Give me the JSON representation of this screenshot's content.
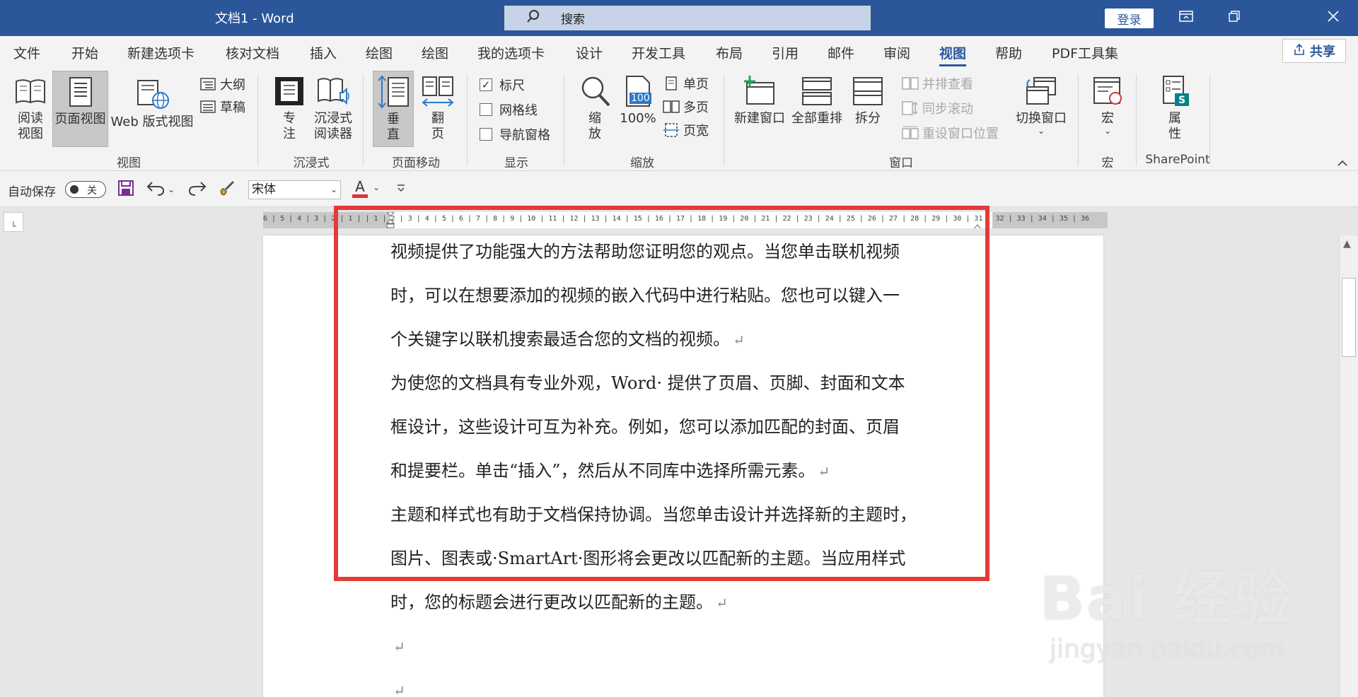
{
  "titlebar": {
    "title": "文档1  -  Word",
    "search_placeholder": "搜索",
    "login_label": "登录"
  },
  "tabs": [
    "文件",
    "开始",
    "新建选项卡",
    "核对文档",
    "插入",
    "绘图",
    "绘图",
    "我的选项卡",
    "设计",
    "开发工具",
    "布局",
    "引用",
    "邮件",
    "审阅",
    "视图",
    "帮助",
    "PDF工具集"
  ],
  "active_tab": "视图",
  "share_label": "共享",
  "ribbon": {
    "views": {
      "group": "视图",
      "read_mode": "阅读\n视图",
      "print_layout": "页面视图",
      "web_layout": "Web 版式视图",
      "outline": "大纲",
      "draft": "草稿"
    },
    "immersive": {
      "group": "沉浸式",
      "focus": "专\n注",
      "immersive_reader": "沉浸式\n阅读器"
    },
    "page_movement": {
      "group": "页面移动",
      "vertical": "垂\n直",
      "side_to_side": "翻\n页"
    },
    "show": {
      "group": "显示",
      "ruler": "标尺",
      "ruler_checked": true,
      "gridlines": "网格线",
      "gridlines_checked": false,
      "nav_pane": "导航窗格",
      "nav_pane_checked": false
    },
    "zoom": {
      "group": "缩放",
      "zoom": "缩\n放",
      "zoom100": "100%",
      "zoom100_icon_text": "100",
      "one_page": "单页",
      "multi_page": "多页",
      "page_width": "页宽"
    },
    "window": {
      "group": "窗口",
      "new_window": "新建窗口",
      "arrange_all": "全部重排",
      "split": "拆分",
      "side_by_side": "并排查看",
      "sync_scroll": "同步滚动",
      "reset_position": "重设窗口位置",
      "switch_windows": "切换窗口"
    },
    "macros": {
      "group": "宏",
      "macros": "宏"
    },
    "sharepoint": {
      "group": "SharePoint",
      "properties": "属\n性"
    }
  },
  "qat": {
    "autosave_label": "自动保存",
    "autosave_state": "关",
    "font_name": "宋体",
    "font_color": "#e03030",
    "font_color_letter": "A"
  },
  "document": {
    "lines": [
      {
        "text": "视频提供了功能强大的方法帮助您证明您的观点。当您单击联机视频",
        "pm": false
      },
      {
        "text": "时，可以在想要添加的视频的嵌入代码中进行粘贴。您也可以键入一",
        "pm": false
      },
      {
        "text": "个关键字以联机搜索最适合您的文档的视频。",
        "pm": true
      },
      {
        "text": "为使您的文档具有专业外观，Word· 提供了页眉、页脚、封面和文本",
        "pm": false
      },
      {
        "text": "框设计，这些设计可互为补充。例如，您可以添加匹配的封面、页眉",
        "pm": false
      },
      {
        "text": "和提要栏。单击“插入”，然后从不同库中选择所需元素。",
        "pm": true
      },
      {
        "text": "主题和样式也有助于文档保持协调。当您单击设计并选择新的主题时，",
        "pm": false
      },
      {
        "text": "图片、图表或·SmartArt·图形将会更改以匹配新的主题。当应用样式",
        "pm": false
      },
      {
        "text": "时，您的标题会进行更改以匹配新的主题。",
        "pm": true
      },
      {
        "text": "",
        "pm": true
      },
      {
        "text": "",
        "pm": true
      }
    ],
    "paragraph_mark": "↵",
    "ruler_numbers": "6 | 5 | 4 | 3 | 2 | 1 |   | 1 | 2 | 3 | 4 | 5 | 6 | 7 | 8 | 9 | 10 | 11 | 12 | 13 | 14 | 15 | 16 | 17 | 18 | 19 | 20 | 21 | 22 | 23 | 24 | 25 | 26 | 27 | 28 | 29 | 30 | 31 | 32 | 33 | 34 | 35 | 36"
  },
  "highlight_color": "#e43a3a",
  "watermark": {
    "brand": "Bai 经验",
    "url": "jingyan.baidu.com"
  },
  "icons": {
    "search": "search-icon",
    "restore_ribbon": "ribbon-display-icon",
    "minimize": "minimize-icon",
    "close": "close-icon"
  }
}
